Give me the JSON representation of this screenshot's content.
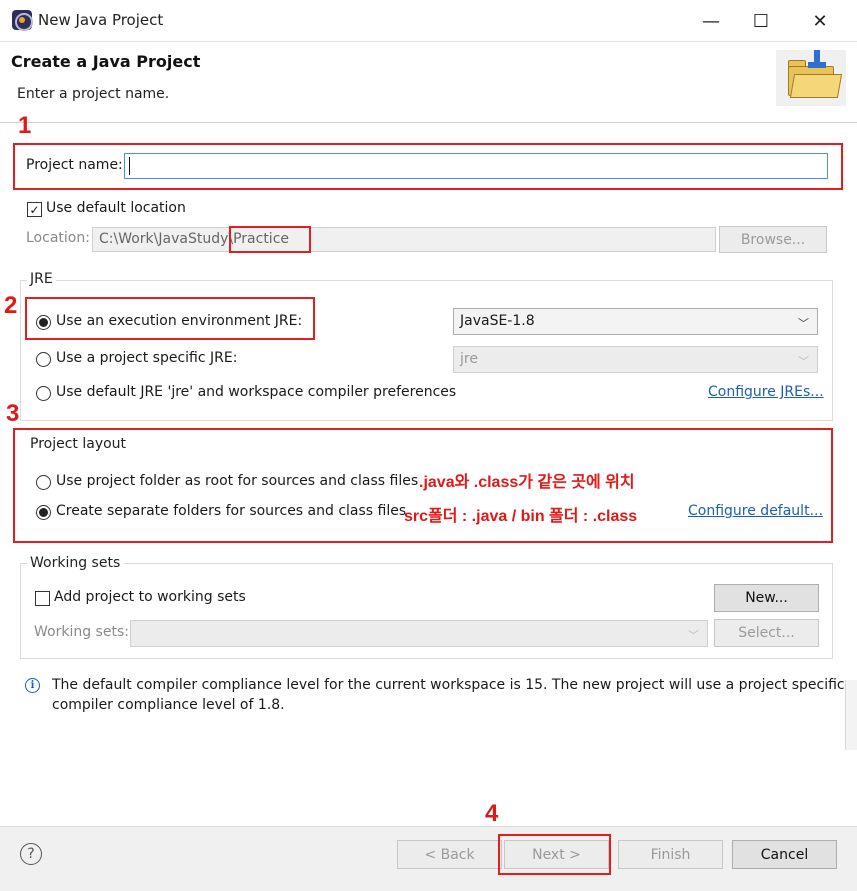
{
  "window": {
    "title": "New Java Project",
    "minimize_glyph": "—",
    "maximize_glyph": "☐",
    "close_glyph": "✕"
  },
  "header": {
    "heading": "Create a Java Project",
    "description": "Enter a project name."
  },
  "project_name": {
    "label": "Project name:",
    "value": ""
  },
  "location": {
    "use_default_label": "Use default location",
    "use_default_checked": true,
    "label": "Location:",
    "value": "C:\\Work\\JavaStudy\\Practice",
    "browse_label": "Browse..."
  },
  "jre": {
    "group_title": "JRE",
    "options": [
      {
        "label": "Use an execution environment JRE:",
        "selected": true
      },
      {
        "label": "Use a project specific JRE:",
        "selected": false
      },
      {
        "label": "Use default JRE 'jre' and workspace compiler preferences",
        "selected": false
      }
    ],
    "execution_env_value": "JavaSE-1.8",
    "project_jre_value": "jre",
    "configure_link": "Configure JREs..."
  },
  "project_layout": {
    "group_title": "Project layout",
    "options": [
      {
        "label": "Use project folder as root for sources and class files",
        "selected": false
      },
      {
        "label": "Create separate folders for sources and class files",
        "selected": true
      }
    ],
    "configure_link": "Configure default..."
  },
  "working_sets": {
    "group_title": "Working sets",
    "add_label": "Add project to working sets",
    "add_checked": false,
    "new_button": "New...",
    "sets_label": "Working sets:",
    "select_button": "Select..."
  },
  "info": {
    "line1": "The default compiler compliance level for the current workspace is 15. The new project will use a project specific",
    "line2": "compiler compliance level of 1.8."
  },
  "buttons": {
    "back": "< Back",
    "next": "Next >",
    "finish": "Finish",
    "cancel": "Cancel",
    "help": "?"
  },
  "annotations": {
    "num1": "1",
    "num2": "2",
    "num3": "3",
    "num4": "4",
    "note_layout_root": ".java와 .class가 같은 곳에 위치",
    "note_layout_separate": "src폴더 : .java / bin 폴더 : .class"
  },
  "colors": {
    "annotation_red": "#e02020",
    "link_blue": "#1a5fb4",
    "input_focus": "#4a90d9"
  }
}
